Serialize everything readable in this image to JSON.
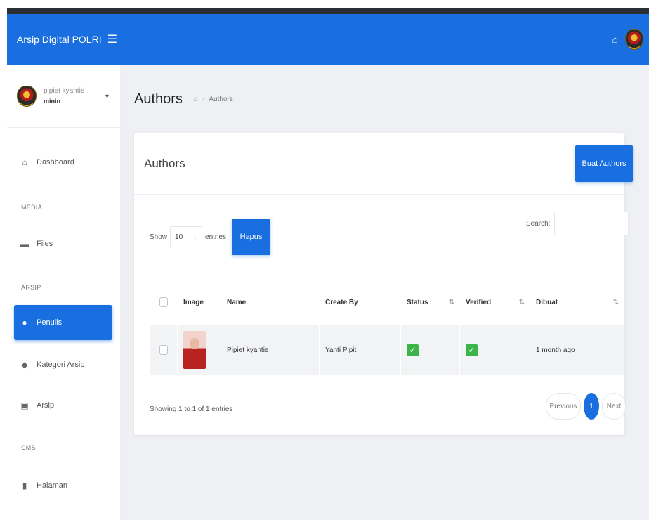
{
  "header": {
    "brand": "Arsip Digital POLRI",
    "menu_icon": "hamburger-icon",
    "home_icon": "home-icon",
    "logo": "polri-emblem"
  },
  "sidebar": {
    "user": {
      "name": "pipiet kyantie",
      "role": "minin"
    },
    "items": [
      {
        "label": "Dashboard",
        "icon": "home-icon"
      },
      {
        "category": "MEDIA"
      },
      {
        "label": "Files",
        "icon": "folder-icon"
      },
      {
        "category": "ARSIP"
      },
      {
        "label": "Penulis",
        "icon": "user-icon",
        "active": true
      },
      {
        "label": "Kategori Arsip",
        "icon": "tags-icon"
      },
      {
        "label": "Arsip",
        "icon": "archive-icon"
      },
      {
        "category": "CMS"
      },
      {
        "label": "Halaman",
        "icon": "page-icon"
      }
    ]
  },
  "page": {
    "title": "Authors",
    "breadcrumb": {
      "current": "Authors"
    }
  },
  "card": {
    "title": "Authors",
    "create_button": "Buat Authors",
    "show_label": "Show",
    "entries_value": "10",
    "entries_label": "entries",
    "delete_button": "Hapus",
    "search_label": "Search:"
  },
  "table": {
    "columns": [
      "Image",
      "Name",
      "Create By",
      "Status",
      "Verified",
      "Dibuat"
    ],
    "rows": [
      {
        "name": "Pipiet kyantie",
        "created_by": "Yanti Pipit",
        "status": true,
        "verified": true,
        "dibuat": "1 month ago"
      }
    ]
  },
  "footer": {
    "info": "Showing 1 to 1 of 1 entries",
    "prev": "Previous",
    "page": "1",
    "next": "Next"
  },
  "colors": {
    "primary": "#1a6fe0",
    "success": "#3bb54a",
    "background": "#eef0f3"
  }
}
